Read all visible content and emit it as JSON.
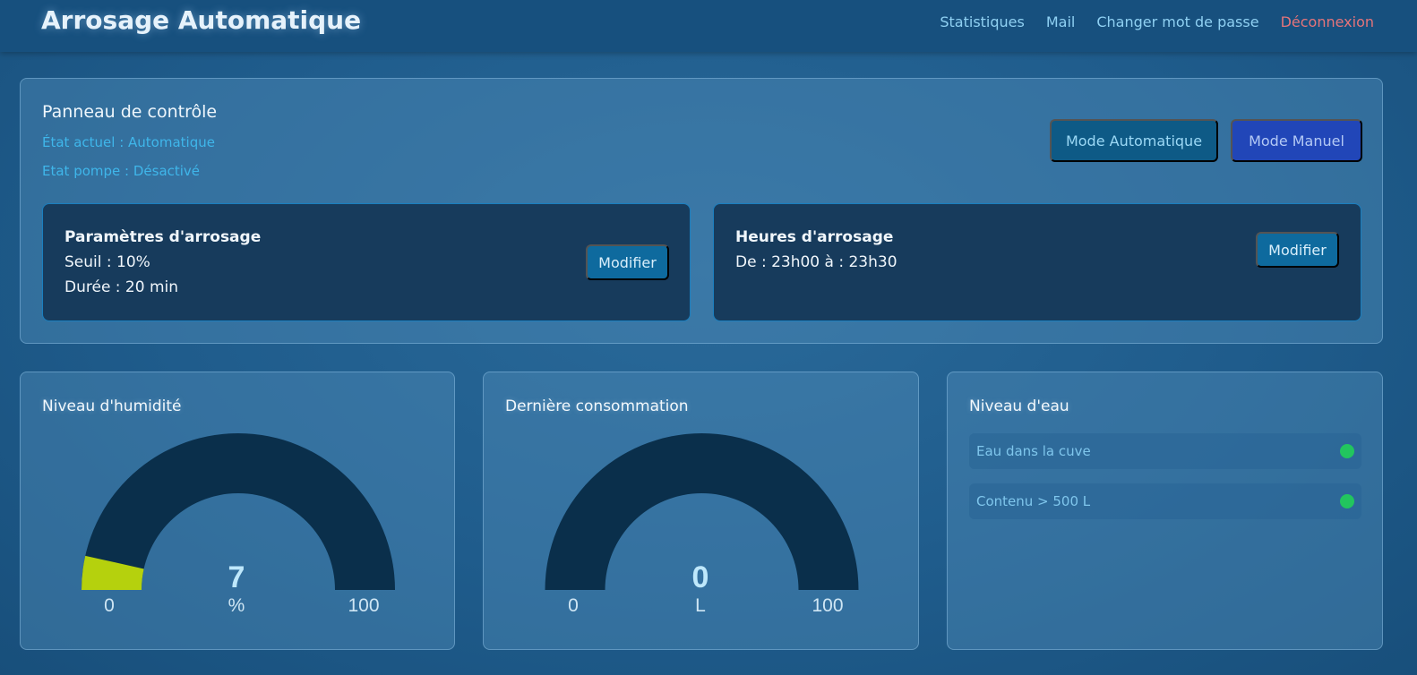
{
  "header": {
    "title": "Arrosage Automatique",
    "nav": {
      "stats": "Statistiques",
      "mail": "Mail",
      "password": "Changer mot de passe",
      "logout": "Déconnexion"
    }
  },
  "control_panel": {
    "title": "Panneau de contrôle",
    "current_state": "État actuel : Automatique",
    "pump_state": "Etat pompe : Désactivé",
    "btn_auto": "Mode Automatique",
    "btn_manual": "Mode Manuel",
    "watering_params": {
      "title": "Paramètres d'arrosage",
      "threshold": "Seuil : 10%",
      "duration": "Durée : 20 min",
      "button": "Modifier"
    },
    "watering_hours": {
      "title": "Heures d'arrosage",
      "range": "De : 23h00 à : 23h30",
      "button": "Modifier"
    }
  },
  "gauges": {
    "humidity": {
      "title": "Niveau d'humidité",
      "value": "7",
      "unit": "%",
      "min": "0",
      "max": "100",
      "fraction": 0.07,
      "fill_color": "#b5d10d"
    },
    "consumption": {
      "title": "Dernière consommation",
      "value": "0",
      "unit": "L",
      "min": "0",
      "max": "100",
      "fraction": 0,
      "fill_color": "#b5d10d"
    },
    "track_color": "#0a2f4b",
    "value_color": "#bfe8fb"
  },
  "water_level": {
    "title": "Niveau d'eau",
    "items": [
      {
        "label": "Eau dans la cuve",
        "status_color": "#22c55e"
      },
      {
        "label": "Contenu > 500 L",
        "status_color": "#22c55e"
      }
    ]
  }
}
